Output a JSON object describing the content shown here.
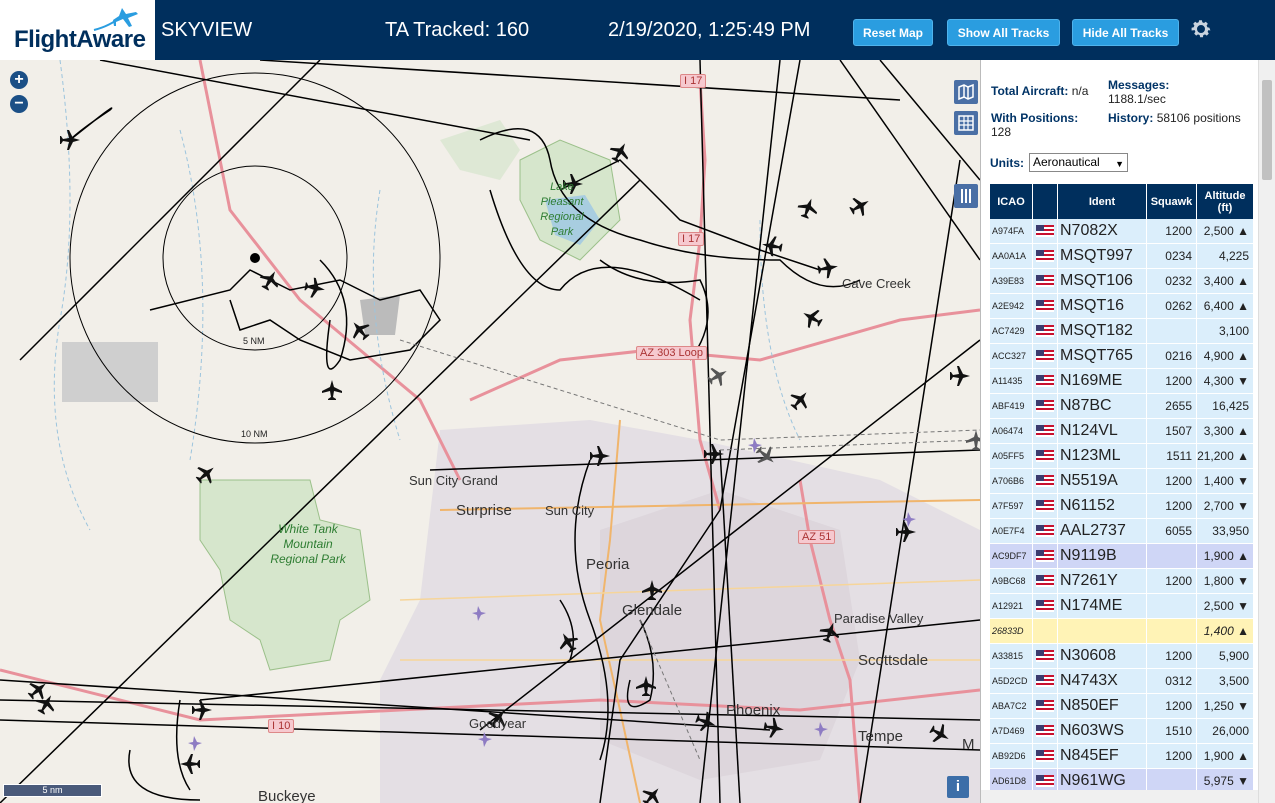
{
  "header": {
    "logo": "FlightAware",
    "app_name": "SKYVIEW",
    "ta_tracked": "TA Tracked: 160",
    "datetime": "2/19/2020, 1:25:49 PM",
    "buttons": {
      "reset_map": "Reset Map",
      "show_all": "Show All Tracks",
      "hide_all": "Hide All Tracks"
    },
    "settings_icon": "gear-icon"
  },
  "map": {
    "zoom_in": "+",
    "zoom_out": "−",
    "scale": "5 nm",
    "info": "i",
    "range_rings": [
      "5 NM",
      "10 NM"
    ],
    "places": {
      "cave_creek": "Cave Creek",
      "sun_city_grand": "Sun City Grand",
      "surprise": "Surprise",
      "sun_city": "Sun City",
      "peoria": "Peoria",
      "glendale": "Glendale",
      "paradise_valley": "Paradise Valley",
      "scottsdale": "Scottsdale",
      "phoenix": "Phoenix",
      "tempe": "Tempe",
      "goodyear": "Goodyear",
      "buckeye": "Buckeye",
      "mesa": "M",
      "lake_pleasant": "Lake Pleasant Regional Park",
      "white_tank": "White Tank Mountain Regional Park"
    },
    "roads": {
      "i17_north": "I 17",
      "i17_mid": "I 17",
      "az303": "AZ 303 Loop",
      "az51": "AZ 51",
      "i10": "I 10"
    }
  },
  "panel": {
    "total_aircraft_label": "Total Aircraft:",
    "total_aircraft_value": "n/a",
    "with_positions_label": "With Positions:",
    "with_positions_value": "128",
    "messages_label": "Messages:",
    "messages_value": "1188.1/sec",
    "history_label": "History:",
    "history_value": "58106 positions",
    "units_label": "Units:",
    "units_value": "Aeronautical",
    "columns": {
      "icao": "ICAO",
      "ident": "Ident",
      "squawk": "Squawk",
      "altitude": "Altitude (ft)"
    },
    "rows": [
      {
        "icao": "A974FA",
        "ident": "N7082X",
        "squawk": "1200",
        "alt": "2,500 ▲",
        "style": "normal"
      },
      {
        "icao": "AA0A1A",
        "ident": "MSQT997",
        "squawk": "0234",
        "alt": "4,225",
        "style": "normal"
      },
      {
        "icao": "A39E83",
        "ident": "MSQT106",
        "squawk": "0232",
        "alt": "3,400 ▲",
        "style": "normal"
      },
      {
        "icao": "A2E942",
        "ident": "MSQT16",
        "squawk": "0262",
        "alt": "6,400 ▲",
        "style": "normal"
      },
      {
        "icao": "AC7429",
        "ident": "MSQT182",
        "squawk": "",
        "alt": "3,100",
        "style": "normal"
      },
      {
        "icao": "ACC327",
        "ident": "MSQT765",
        "squawk": "0216",
        "alt": "4,900 ▲",
        "style": "normal"
      },
      {
        "icao": "A11435",
        "ident": "N169ME",
        "squawk": "1200",
        "alt": "4,300 ▼",
        "style": "normal"
      },
      {
        "icao": "ABF419",
        "ident": "N87BC",
        "squawk": "2655",
        "alt": "16,425",
        "style": "normal"
      },
      {
        "icao": "A06474",
        "ident": "N124VL",
        "squawk": "1507",
        "alt": "3,300 ▲",
        "style": "normal"
      },
      {
        "icao": "A05FF5",
        "ident": "N123ML",
        "squawk": "1511",
        "alt": "21,200 ▲",
        "style": "normal"
      },
      {
        "icao": "A706B6",
        "ident": "N5519A",
        "squawk": "1200",
        "alt": "1,400 ▼",
        "style": "normal"
      },
      {
        "icao": "A7F597",
        "ident": "N61152",
        "squawk": "1200",
        "alt": "2,700 ▼",
        "style": "normal"
      },
      {
        "icao": "A0E7F4",
        "ident": "AAL2737",
        "squawk": "6055",
        "alt": "33,950",
        "style": "normal"
      },
      {
        "icao": "AC9DF7",
        "ident": "N9119B",
        "squawk": "",
        "alt": "1,900 ▲",
        "style": "selected"
      },
      {
        "icao": "A9BC68",
        "ident": "N7261Y",
        "squawk": "1200",
        "alt": "1,800 ▼",
        "style": "normal"
      },
      {
        "icao": "A12921",
        "ident": "N174ME",
        "squawk": "",
        "alt": "2,500 ▼",
        "style": "normal"
      },
      {
        "icao": "26833D",
        "ident": "",
        "squawk": "",
        "alt": "1,400 ▲",
        "style": "yellow"
      },
      {
        "icao": "A33815",
        "ident": "N30608",
        "squawk": "1200",
        "alt": "5,900",
        "style": "normal"
      },
      {
        "icao": "A5D2CD",
        "ident": "N4743X",
        "squawk": "0312",
        "alt": "3,500",
        "style": "normal"
      },
      {
        "icao": "ABA7C2",
        "ident": "N850EF",
        "squawk": "1200",
        "alt": "1,250 ▼",
        "style": "normal"
      },
      {
        "icao": "A7D469",
        "ident": "N603WS",
        "squawk": "1510",
        "alt": "26,000",
        "style": "normal"
      },
      {
        "icao": "AB92D6",
        "ident": "N845EF",
        "squawk": "1200",
        "alt": "1,900 ▲",
        "style": "normal"
      },
      {
        "icao": "AD61D8",
        "ident": "N961WG",
        "squawk": "",
        "alt": "5,975 ▼",
        "style": "selected"
      }
    ]
  }
}
